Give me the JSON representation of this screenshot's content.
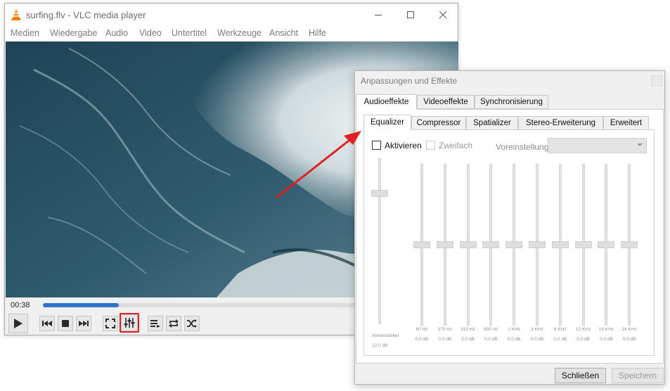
{
  "window": {
    "title": "surfing.flv - VLC media player",
    "menu": [
      "Medien",
      "Wiedergabe",
      "Audio",
      "Video",
      "Untertitel",
      "Werkzeuge",
      "Ansicht",
      "Hilfe"
    ]
  },
  "playback": {
    "elapsed": "00:38",
    "progress_fraction": 0.22
  },
  "controls": {
    "icons": [
      "play-icon",
      "previous-icon",
      "stop-icon",
      "next-icon",
      "fullscreen-icon",
      "equalizer-settings-icon",
      "playlist-icon",
      "loop-icon",
      "shuffle-icon"
    ]
  },
  "dialog": {
    "title": "Anpassungen und Effekte",
    "main_tabs": [
      "Audioeffekte",
      "Videoeffekte",
      "Synchronisierung"
    ],
    "sub_tabs": [
      "Equalizer",
      "Compressor",
      "Spatializer",
      "Stereo-Erweiterung",
      "Erweitert"
    ],
    "enable_label": "Aktivieren",
    "twopass_label": "Zweifach",
    "preset_label": "Voreinstellung",
    "preamp": {
      "label": "Vorverstärker",
      "value": "12.0 dB",
      "level": 0.8
    },
    "bands": [
      {
        "freq": "60 Hz",
        "value": "0.0 dB",
        "level": 0.5
      },
      {
        "freq": "170 Hz",
        "value": "0.0 dB",
        "level": 0.5
      },
      {
        "freq": "310 Hz",
        "value": "0.0 dB",
        "level": 0.5
      },
      {
        "freq": "600 Hz",
        "value": "0.0 dB",
        "level": 0.5
      },
      {
        "freq": "1 KHz",
        "value": "0.0 dB",
        "level": 0.5
      },
      {
        "freq": "3 KHz",
        "value": "0.0 dB",
        "level": 0.5
      },
      {
        "freq": "6 KHz",
        "value": "0.0 dB",
        "level": 0.5
      },
      {
        "freq": "12 KHz",
        "value": "0.0 dB",
        "level": 0.5
      },
      {
        "freq": "14 KHz",
        "value": "0.0 dB",
        "level": 0.5
      },
      {
        "freq": "16 KHz",
        "value": "0.0 dB",
        "level": 0.5
      }
    ],
    "close_button": "Schließen",
    "save_button": "Speichern"
  },
  "colors": {
    "highlight": "#e02020",
    "seek_fill": "#2e73c8"
  }
}
